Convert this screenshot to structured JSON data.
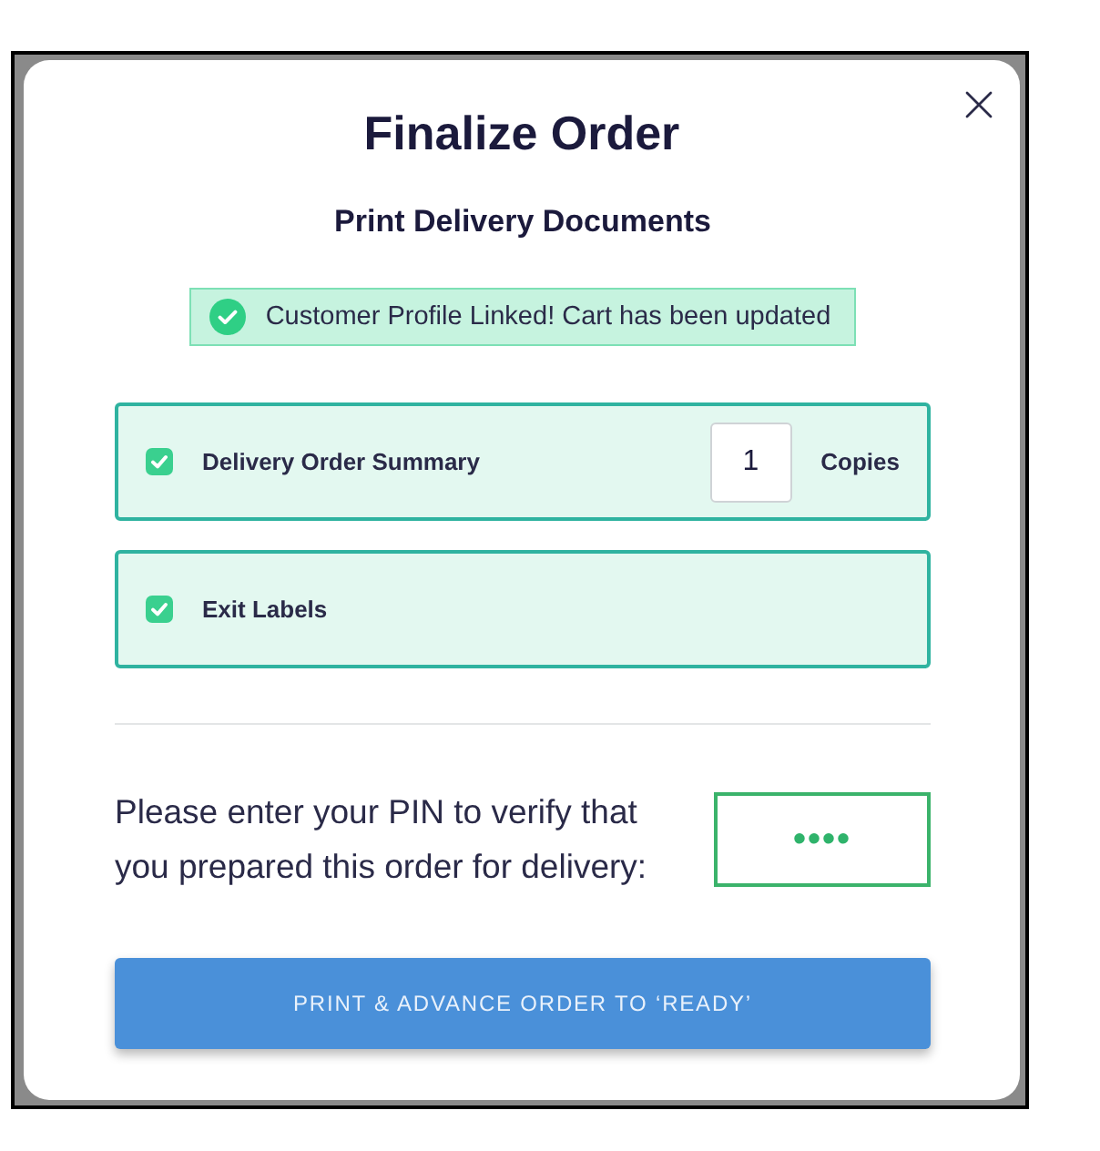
{
  "dialog": {
    "title": "Finalize Order",
    "subtitle": "Print Delivery Documents"
  },
  "banner": {
    "message": "Customer Profile Linked! Cart has been updated"
  },
  "documents": [
    {
      "kind": "copies",
      "label": "Delivery Order Summary",
      "checked": true,
      "copies": "1",
      "copies_label": "Copies"
    },
    {
      "kind": "plain",
      "label": "Exit Labels",
      "checked": true
    }
  ],
  "pin": {
    "prompt": "Please enter your PIN to verify that you prepared this order for delivery:",
    "value": "••••"
  },
  "submit_button": "PRINT & ADVANCE ORDER TO ‘READY’"
}
